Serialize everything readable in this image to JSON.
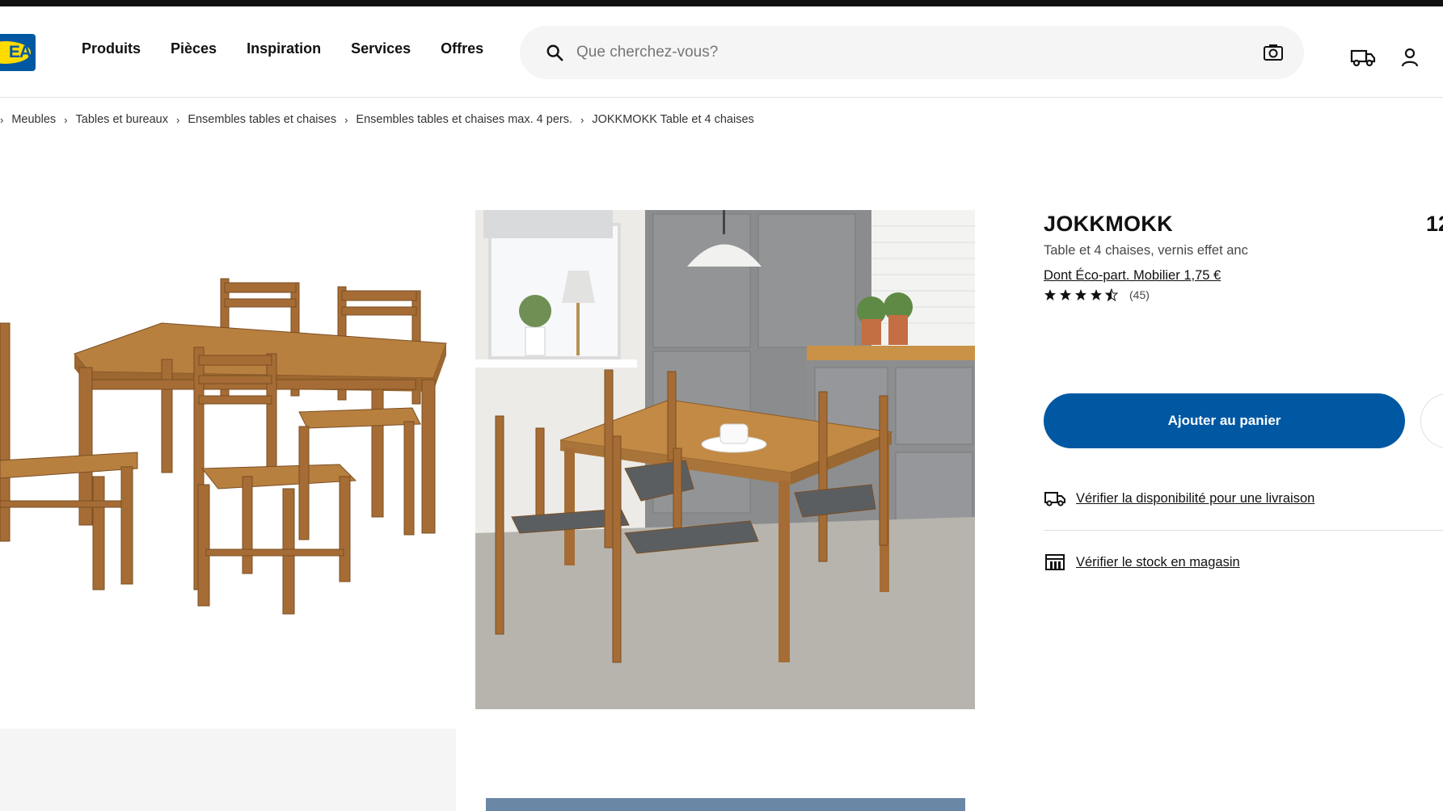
{
  "logo": {
    "text": "EA"
  },
  "nav": {
    "items": [
      {
        "label": "Produits"
      },
      {
        "label": "Pièces"
      },
      {
        "label": "Inspiration"
      },
      {
        "label": "Services"
      },
      {
        "label": "Offres"
      }
    ]
  },
  "search": {
    "placeholder": "Que cherchez-vous?"
  },
  "breadcrumb": {
    "items": [
      {
        "label": "Meubles"
      },
      {
        "label": "Tables et bureaux"
      },
      {
        "label": "Ensembles tables et chaises"
      },
      {
        "label": "Ensembles tables et chaises max. 4 pers."
      },
      {
        "label": "JOKKMOKK Table et 4 chaises"
      }
    ]
  },
  "product": {
    "name": "JOKKMOKK",
    "price_partial": "12",
    "description": "Table et 4 chaises, vernis effet anc",
    "eco_part": "Dont Éco-part. Mobilier 1,75 €",
    "rating_stars": 4.5,
    "reviews": "(45)"
  },
  "actions": {
    "add_to_cart": "Ajouter au panier",
    "delivery_check": "Vérifier la disponibilité pour une livraison",
    "store_check": "Vérifier le stock en magasin"
  },
  "colors": {
    "brand_blue": "#0058a3",
    "brand_yellow": "#ffdb00",
    "wood": "#b07a3f"
  },
  "icons": {
    "search": "search-icon",
    "camera": "camera-icon",
    "delivery": "truck-icon",
    "account": "user-icon",
    "store": "store-icon",
    "star": "star-icon"
  }
}
